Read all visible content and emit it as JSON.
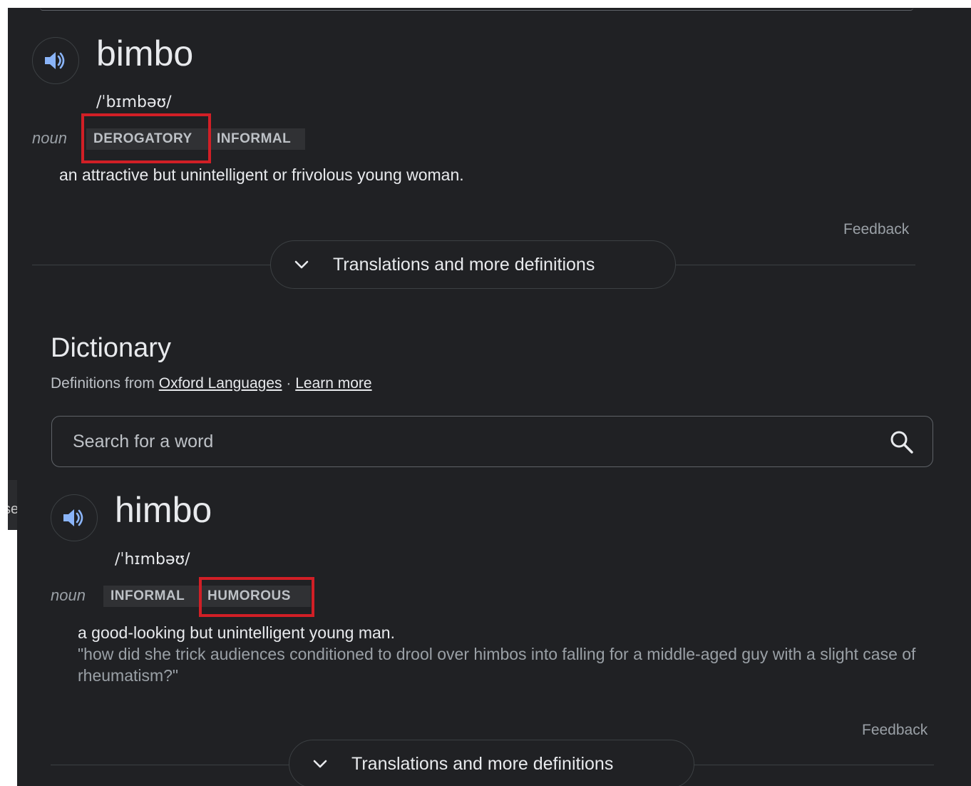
{
  "sidebar_fragment": {
    "text": "se"
  },
  "entries": [
    {
      "word": "bimbo",
      "phonetic": "/ˈbɪmbəʊ/",
      "part_of_speech": "noun",
      "tags": [
        "DEROGATORY",
        "INFORMAL"
      ],
      "highlighted_tag": "DEROGATORY",
      "definition": "an attractive but unintelligent or frivolous young woman.",
      "example": "",
      "feedback": "Feedback",
      "more_label": "Translations and more definitions"
    },
    {
      "word": "himbo",
      "phonetic": "/ˈhɪmbəʊ/",
      "part_of_speech": "noun",
      "tags": [
        "INFORMAL",
        "HUMOROUS"
      ],
      "highlighted_tag": "HUMOROUS",
      "definition": "a good-looking but unintelligent young man.",
      "example": "\"how did she trick audiences conditioned to drool over himbos into falling for a middle-aged guy with a slight case of rheumatism?\"",
      "feedback": "Feedback",
      "more_label": "Translations and more definitions"
    }
  ],
  "dictionary": {
    "title": "Dictionary",
    "source_prefix": "Definitions from",
    "source_link": "Oxford Languages",
    "separator": "·",
    "learn_more": "Learn more",
    "search_placeholder": "Search for a word"
  },
  "colors": {
    "background": "#202124",
    "text": "#e8eaed",
    "muted": "#9aa0a6",
    "tag_background": "#303134",
    "highlight_box": "#d11f26",
    "speaker_icon": "#8ab4f8"
  },
  "icons": {
    "speaker": "speaker-icon",
    "chevron": "chevron-down-icon",
    "search": "search-icon"
  }
}
